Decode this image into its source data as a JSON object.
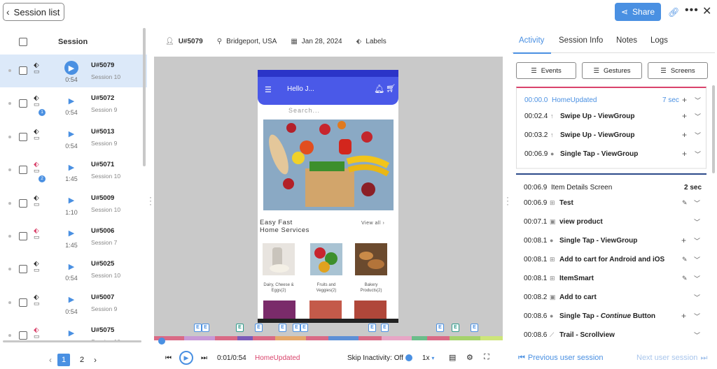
{
  "header": {
    "back_label": "Session list",
    "share_label": "Share"
  },
  "list": {
    "column_title": "Session",
    "rows": [
      {
        "uid": "U#5079",
        "session": "Session 10",
        "duration": "0:54",
        "badge": ""
      },
      {
        "uid": "U#5072",
        "session": "Session 9",
        "duration": "0:54",
        "badge": "1"
      },
      {
        "uid": "U#5013",
        "session": "Session 9",
        "duration": "0:54",
        "badge": ""
      },
      {
        "uid": "U#5071",
        "session": "Session 10",
        "duration": "1:45",
        "badge": "2"
      },
      {
        "uid": "U#5009",
        "session": "Session 10",
        "duration": "1:10",
        "badge": ""
      },
      {
        "uid": "U#5006",
        "session": "Session 7",
        "duration": "1:45",
        "badge": ""
      },
      {
        "uid": "U#5025",
        "session": "Session 10",
        "duration": "0:54",
        "badge": ""
      },
      {
        "uid": "U#5007",
        "session": "Session 9",
        "duration": "0:54",
        "badge": ""
      },
      {
        "uid": "U#5075",
        "session": "Session 10",
        "duration": "",
        "badge": ""
      }
    ],
    "pages": [
      "1",
      "2"
    ]
  },
  "meta": {
    "user": "U#5079",
    "location": "Bridgeport, USA",
    "date": "Jan 28, 2024",
    "labels": "Labels"
  },
  "app": {
    "greeting": "Hello J...",
    "search_placeholder": "Search...",
    "section_title_1": "Easy Fast",
    "section_title_2": "Home Services",
    "view_all": "View all",
    "categories": [
      {
        "label": "Dairy, Cheese & Eggs(2)"
      },
      {
        "label": "Fruits and Veggies(2)"
      },
      {
        "label": "Bakery Products(2)"
      }
    ]
  },
  "controls": {
    "time": "0:01/0:54",
    "current_event": "HomeUpdated",
    "skip_label": "Skip Inactivity: Off",
    "speed": "1x"
  },
  "tabs": [
    "Activity",
    "Session Info",
    "Notes",
    "Logs"
  ],
  "filters": [
    "Events",
    "Gestures",
    "Screens"
  ],
  "group1": {
    "header": {
      "time": "00:00.0",
      "name": "HomeUpdated",
      "duration": "7 sec"
    },
    "rows": [
      {
        "time": "00:02.4",
        "name": "Swipe Up - ViewGroup"
      },
      {
        "time": "00:03.2",
        "name": "Swipe Up - ViewGroup"
      },
      {
        "time": "00:06.9",
        "name": "Single Tap - ViewGroup"
      }
    ]
  },
  "group2": {
    "header": {
      "time": "00:06.9",
      "name": "Item Details Screen",
      "duration": "2 sec"
    },
    "rows": [
      {
        "time": "00:06.9",
        "name": "Test"
      },
      {
        "time": "00:07.1",
        "name": "view product"
      },
      {
        "time": "00:08.1",
        "name": "Single Tap - ViewGroup"
      },
      {
        "time": "00:08.1",
        "name": "Add to cart for Android and iOS"
      },
      {
        "time": "00:08.1",
        "name": "ItemSmart"
      },
      {
        "time": "00:08.2",
        "name": "Add to cart"
      },
      {
        "time": "00:08.6",
        "name_prefix": "Single Tap - ",
        "name_em": "Continue",
        "name_suffix": " Button"
      },
      {
        "time": "00:08.6",
        "name": "Trail - Scrollview"
      }
    ]
  },
  "footer": {
    "prev_label": "Previous user session",
    "next_label": "Next user session"
  },
  "colors": {
    "accent": "#4a90e2",
    "event_red": "#d9436b",
    "app_header": "#4a59e8"
  }
}
